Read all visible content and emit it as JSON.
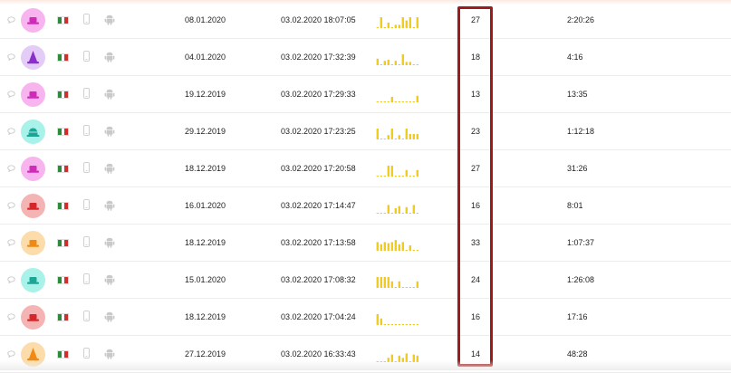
{
  "colors": {
    "sparkline": "#f2cc1a",
    "highlight_border": "#9e1b1b",
    "icon_gray": "#c9c9c9",
    "flag": [
      "#2e8b3c",
      "#ffffff",
      "#d0302d"
    ]
  },
  "rows": [
    {
      "avatar_icon": "hat-icon",
      "avatar_bg": "#f7b4ee",
      "avatar_fg": "#d02ab8",
      "registered": "08.01.2020",
      "last_seen": "03.02.2020 18:07:05",
      "activity": [
        0,
        1,
        0,
        0.5,
        0,
        0.3,
        0.3,
        1,
        0.7,
        1,
        0,
        1
      ],
      "count": "27",
      "duration": "2:20:26"
    },
    {
      "avatar_icon": "wizard-hat-icon",
      "avatar_bg": "#e3ccf5",
      "avatar_fg": "#8a2fc9",
      "registered": "04.01.2020",
      "last_seen": "03.02.2020 17:32:39",
      "activity": [
        0.6,
        0,
        0.4,
        0.5,
        0,
        0.4,
        0,
        1,
        0.3,
        0.3,
        0,
        0
      ],
      "count": "18",
      "duration": "4:16"
    },
    {
      "avatar_icon": "hat-icon",
      "avatar_bg": "#f7b4ee",
      "avatar_fg": "#d02ab8",
      "registered": "19.12.2019",
      "last_seen": "03.02.2020 17:29:33",
      "activity": [
        0,
        0,
        0,
        0,
        0.5,
        0,
        0,
        0,
        0,
        0,
        0,
        0.6
      ],
      "count": "13",
      "duration": "13:35"
    },
    {
      "avatar_icon": "bell-hat-icon",
      "avatar_bg": "#a8f2ea",
      "avatar_fg": "#1aa596",
      "registered": "29.12.2019",
      "last_seen": "03.02.2020 17:23:25",
      "activity": [
        1,
        0,
        0,
        0.4,
        1,
        0,
        0.4,
        0,
        1,
        0.5,
        0.5,
        0.5
      ],
      "count": "23",
      "duration": "1:12:18"
    },
    {
      "avatar_icon": "hat-icon",
      "avatar_bg": "#f7b4ee",
      "avatar_fg": "#d02ab8",
      "registered": "18.12.2019",
      "last_seen": "03.02.2020 17:20:58",
      "activity": [
        0,
        0,
        0,
        1,
        1,
        0,
        0,
        0,
        0.6,
        0,
        0,
        0.6
      ],
      "count": "27",
      "duration": "31:26"
    },
    {
      "avatar_icon": "hat-icon",
      "avatar_bg": "#f5b4b4",
      "avatar_fg": "#d6262a",
      "registered": "16.01.2020",
      "last_seen": "03.02.2020 17:14:47",
      "activity": [
        0,
        0,
        0,
        0.8,
        0,
        0.5,
        0.7,
        0,
        0.6,
        0,
        0.8,
        0
      ],
      "count": "16",
      "duration": "8:01"
    },
    {
      "avatar_icon": "hat-icon",
      "avatar_bg": "#fbdcaa",
      "avatar_fg": "#f08a14",
      "registered": "18.12.2019",
      "last_seen": "03.02.2020 17:13:58",
      "activity": [
        0.8,
        0.6,
        0.8,
        0.7,
        0.8,
        1,
        0.6,
        0.8,
        0,
        0.5,
        0,
        0
      ],
      "count": "33",
      "duration": "1:07:37"
    },
    {
      "avatar_icon": "hat-icon",
      "avatar_bg": "#a8f2ea",
      "avatar_fg": "#1aa596",
      "registered": "15.01.2020",
      "last_seen": "03.02.2020 17:08:32",
      "activity": [
        1,
        1,
        1,
        1,
        0.6,
        0,
        0.6,
        0,
        0,
        0,
        0,
        0.6
      ],
      "count": "24",
      "duration": "1:26:08"
    },
    {
      "avatar_icon": "hat-icon",
      "avatar_bg": "#f5b4b4",
      "avatar_fg": "#d6262a",
      "registered": "18.12.2019",
      "last_seen": "03.02.2020 17:04:24",
      "activity": [
        1,
        0.6,
        0,
        0,
        0,
        0,
        0,
        0,
        0,
        0,
        0,
        0
      ],
      "count": "16",
      "duration": "17:16"
    },
    {
      "avatar_icon": "wizard-hat-icon",
      "avatar_bg": "#fbdcaa",
      "avatar_fg": "#f08a14",
      "registered": "27.12.2019",
      "last_seen": "03.02.2020 16:33:43",
      "activity": [
        0,
        0,
        0,
        0.4,
        0.7,
        0,
        0.6,
        0.4,
        0.8,
        0,
        0.7,
        0.6
      ],
      "count": "14",
      "duration": "48:28"
    }
  ]
}
